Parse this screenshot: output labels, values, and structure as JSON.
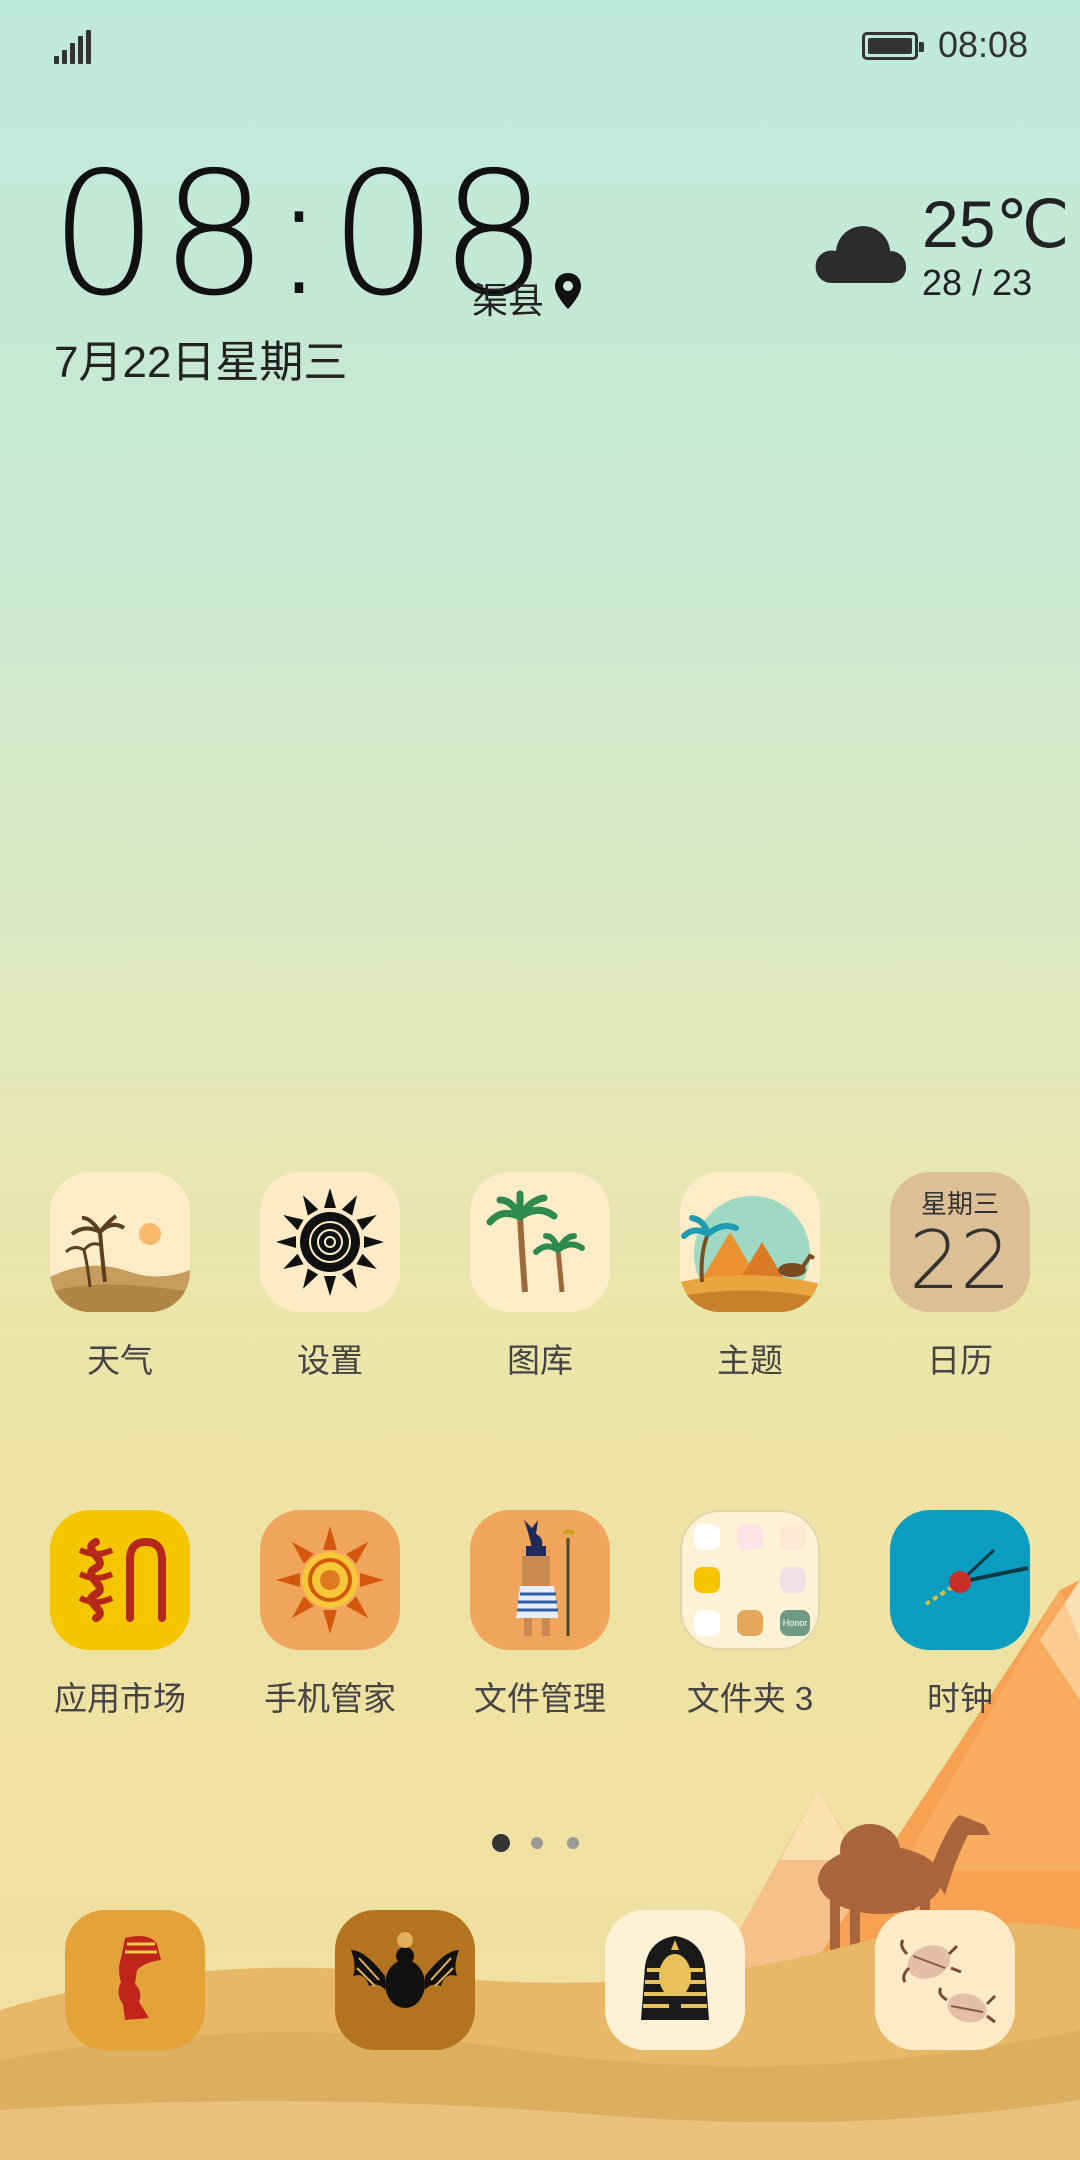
{
  "status_bar": {
    "time": "08:08",
    "signal_icon": "signal-icon",
    "battery_icon": "battery-icon"
  },
  "clock_widget": {
    "time": "08:08",
    "city": "渠县",
    "date": "7月22日星期三",
    "location_icon": "location-pin-icon"
  },
  "weather_widget": {
    "temperature": "25℃",
    "range": "28 / 23",
    "icon": "cloud-icon"
  },
  "apps_row1": [
    {
      "label": "天气",
      "icon": "palm-sunset-icon"
    },
    {
      "label": "设置",
      "icon": "black-sun-icon"
    },
    {
      "label": "图库",
      "icon": "palm-trees-icon"
    },
    {
      "label": "主题",
      "icon": "pyramid-camel-icon"
    },
    {
      "label": "日历",
      "icon": "calendar-icon",
      "weekday": "星期三",
      "day": "22"
    }
  ],
  "apps_row2": [
    {
      "label": "应用市场",
      "icon": "hieroglyph-icon"
    },
    {
      "label": "手机管家",
      "icon": "orange-sun-icon"
    },
    {
      "label": "文件管理",
      "icon": "anubis-icon"
    },
    {
      "label": "文件夹 3",
      "icon": "folder-icon",
      "folder_badge": "Honor"
    },
    {
      "label": "时钟",
      "icon": "clock-icon"
    }
  ],
  "page_indicator": {
    "total": 3,
    "active": 1
  },
  "dock": [
    {
      "icon": "nefertiti-icon"
    },
    {
      "icon": "scarab-wings-icon"
    },
    {
      "icon": "pharaoh-mask-icon"
    },
    {
      "icon": "beetles-icon"
    }
  ],
  "colors": {
    "sky_top": "#bfe9dc",
    "sand": "#e3b46a",
    "pyramid": "#f4a85a",
    "clock_app": "#0a9dbf",
    "market_app": "#f5c500"
  }
}
